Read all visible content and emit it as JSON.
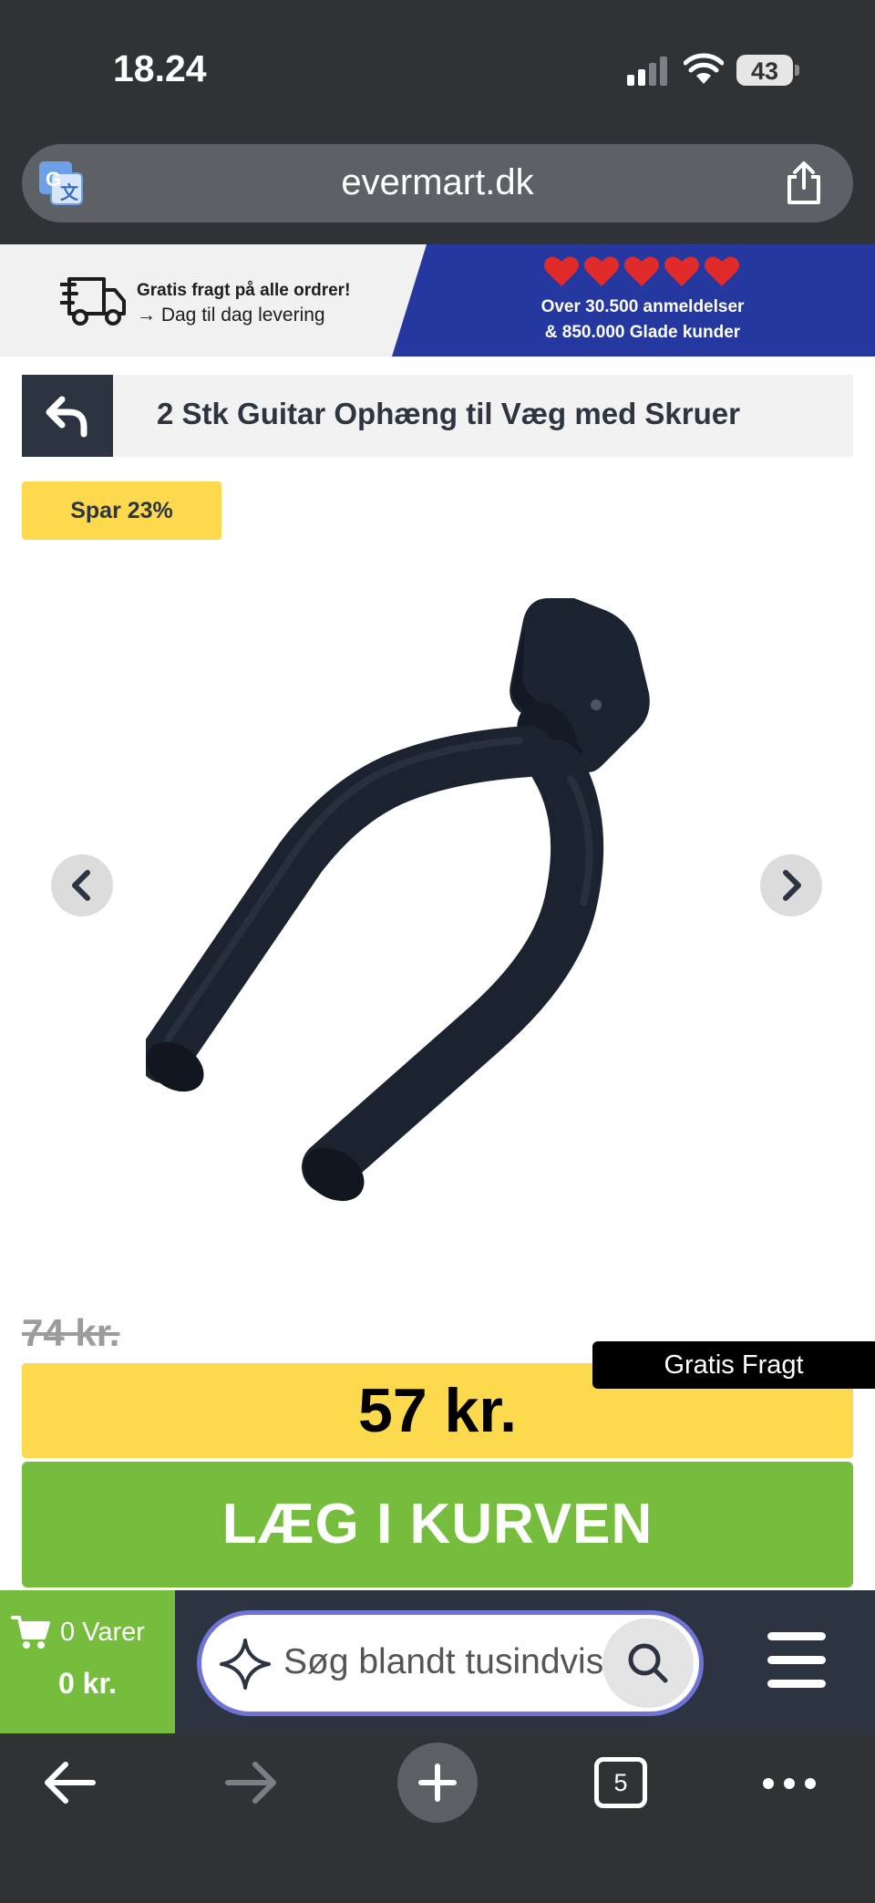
{
  "status_bar": {
    "time": "18.24",
    "battery_level": "43",
    "signal_bars_active": 2,
    "signal_bars_total": 4
  },
  "address_bar": {
    "url": "evermart.dk",
    "translate_icon": "translate-icon",
    "share_icon": "share-icon"
  },
  "promo_banner": {
    "shipping_title": "Gratis fragt på alle ordrer!",
    "shipping_subtitle": "→ Dag til dag levering",
    "hearts_count": 5,
    "reviews_line1": "Over 30.500 anmeldelser",
    "reviews_line2": "& 850.000 Glade kunder",
    "colors": {
      "blue_panel": "#2438a0",
      "heart": "#e12b2b"
    }
  },
  "product": {
    "title": "2 Stk Guitar Ophæng til Væg med Skruer",
    "save_badge": "Spar 23%",
    "old_price": "74 kr.",
    "price": "57 kr.",
    "free_shipping_tag": "Gratis Fragt",
    "add_to_cart": "LÆG I KURVEN",
    "image_subject": "black guitar wall hanger",
    "colors": {
      "accent_yellow": "#fdd94e",
      "accent_green": "#76bd3e",
      "dark": "#2c3441"
    }
  },
  "sticky_bar": {
    "cart_count": "0 Varer",
    "cart_total": "0 kr.",
    "search_placeholder": "Søg blandt tusindvis af produkter"
  },
  "browser_toolbar": {
    "tab_count": "5"
  }
}
